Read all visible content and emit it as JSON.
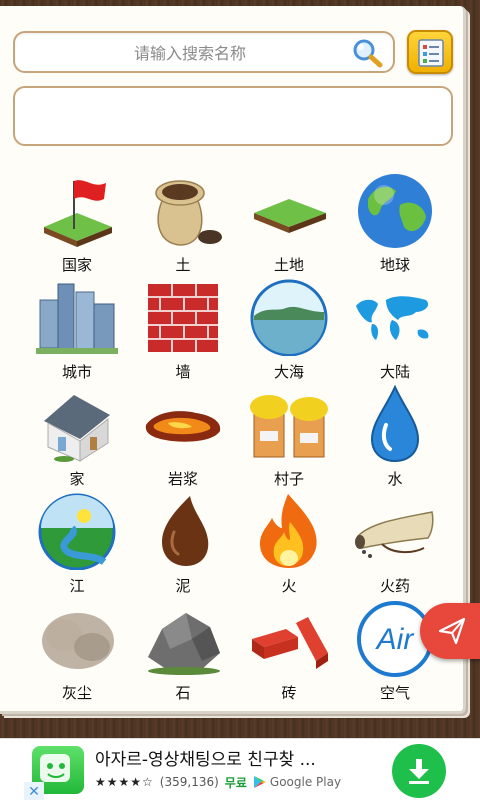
{
  "search": {
    "placeholder": "请输入搜索名称",
    "value": ""
  },
  "result_text": "",
  "items": [
    {
      "label": "国家",
      "icon": "flag-on-grass-icon"
    },
    {
      "label": "土",
      "icon": "soil-sack-icon"
    },
    {
      "label": "土地",
      "icon": "land-tile-icon"
    },
    {
      "label": "地球",
      "icon": "earth-globe-icon"
    },
    {
      "label": "城市",
      "icon": "city-skyscrapers-icon"
    },
    {
      "label": "墙",
      "icon": "brick-wall-icon"
    },
    {
      "label": "大海",
      "icon": "sea-landscape-icon"
    },
    {
      "label": "大陆",
      "icon": "world-map-continents-icon"
    },
    {
      "label": "家",
      "icon": "house-icon"
    },
    {
      "label": "岩浆",
      "icon": "lava-icon"
    },
    {
      "label": "村子",
      "icon": "village-huts-icon"
    },
    {
      "label": "水",
      "icon": "water-drop-icon"
    },
    {
      "label": "江",
      "icon": "river-landscape-icon"
    },
    {
      "label": "泥",
      "icon": "mud-drop-icon"
    },
    {
      "label": "火",
      "icon": "fire-icon"
    },
    {
      "label": "火药",
      "icon": "gunpowder-horn-icon"
    },
    {
      "label": "灰尘",
      "icon": "dust-cloud-icon"
    },
    {
      "label": "石",
      "icon": "stone-rock-icon"
    },
    {
      "label": "砖",
      "icon": "bricks-icon"
    },
    {
      "label": "空气",
      "icon": "air-circle-icon"
    }
  ],
  "ad": {
    "title": "아자르-영상채팅으로 친구찾 ...",
    "stars": "★★★★☆",
    "rating_count": "(359,136)",
    "price": "무료",
    "store": "Google Play",
    "close": "✕"
  },
  "colors": {
    "accent": "#e8473b",
    "frame": "#c7a57a",
    "download": "#1fbf4b"
  }
}
